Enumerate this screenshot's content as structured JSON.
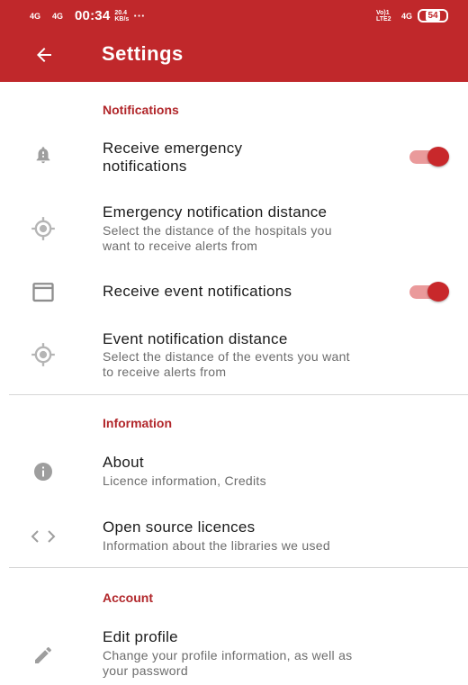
{
  "status_bar": {
    "signal_1": "4G",
    "signal_2": "4G",
    "time": "00:34",
    "speed_value": "20.4",
    "speed_unit": "KB/s",
    "overflow": "···",
    "volte_line1": "Vo)1",
    "volte_line2": "LTE2",
    "network": "4G",
    "battery": "54"
  },
  "app_bar": {
    "title": "Settings",
    "back_icon": "arrow-left-icon"
  },
  "colors": {
    "app_bar": "#c0282b",
    "accent": "#b1262a",
    "toggle_thumb": "#c8282b",
    "toggle_track": "#ea9a9b"
  },
  "sections": {
    "notifications": {
      "header": "Notifications",
      "items": [
        {
          "icon": "bell-alert-icon",
          "title_line1": "Receive emergency",
          "title_line2": "notifications",
          "toggle": true
        },
        {
          "icon": "location-target-icon",
          "title": "Emergency notification distance",
          "summary_line1": "Select the distance of the hospitals you",
          "summary_line2": "want to receive alerts from"
        },
        {
          "icon": "calendar-icon",
          "title": "Receive event notifications",
          "toggle": true
        },
        {
          "icon": "location-target-icon",
          "title": "Event notification distance",
          "summary_line1": "Select the distance of the events you want",
          "summary_line2": "to receive alerts from"
        }
      ]
    },
    "information": {
      "header": "Information",
      "items": [
        {
          "icon": "info-icon",
          "title": "About",
          "summary": "Licence information, Credits"
        },
        {
          "icon": "code-icon",
          "title": "Open source licences",
          "summary": "Information about the libraries we used"
        }
      ]
    },
    "account": {
      "header": "Account",
      "items": [
        {
          "icon": "pencil-icon",
          "title": "Edit profile",
          "summary_line1": "Change your profile information, as well as",
          "summary_line2": "your password"
        }
      ]
    }
  }
}
